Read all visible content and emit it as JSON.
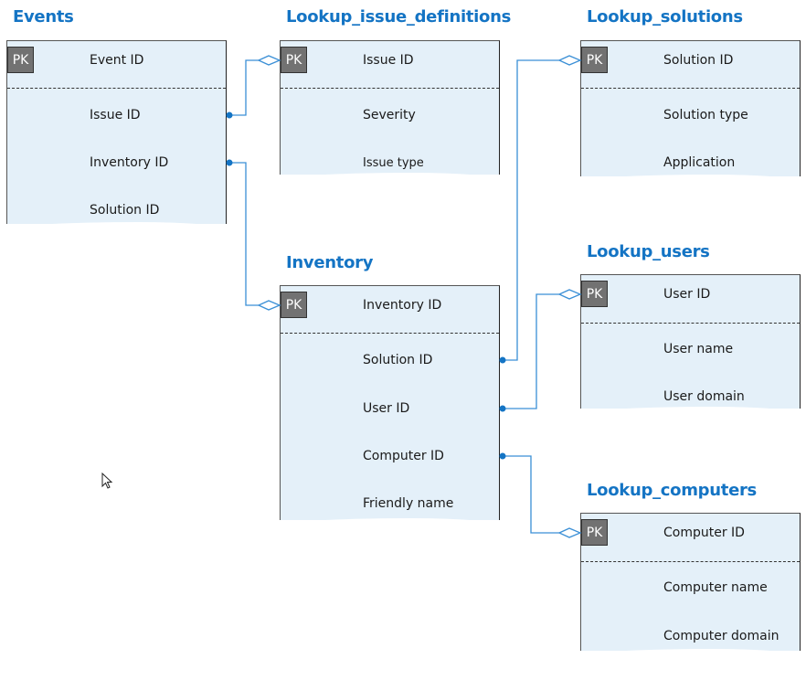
{
  "diagram": {
    "pk_label": "PK",
    "accent_color": "#1474c4",
    "entities": [
      {
        "id": "events",
        "title": "Events",
        "pk_field": "Event ID",
        "fields": [
          "Issue ID",
          "Inventory ID",
          "Solution ID"
        ]
      },
      {
        "id": "lookup_issue_definitions",
        "title": "Lookup_issue_definitions",
        "pk_field": "Issue ID",
        "fields": [
          "Severity",
          "Issue type"
        ]
      },
      {
        "id": "lookup_solutions",
        "title": "Lookup_solutions",
        "pk_field": "Solution ID",
        "fields": [
          "Solution type",
          "Application"
        ]
      },
      {
        "id": "inventory",
        "title": "Inventory",
        "pk_field": "Inventory ID",
        "fields": [
          "Solution ID",
          "User ID",
          "Computer ID",
          "Friendly name"
        ]
      },
      {
        "id": "lookup_users",
        "title": "Lookup_users",
        "pk_field": "User ID",
        "fields": [
          "User name",
          "User domain"
        ]
      },
      {
        "id": "lookup_computers",
        "title": "Lookup_computers",
        "pk_field": "Computer ID",
        "fields": [
          "Computer name",
          "Computer domain"
        ]
      }
    ],
    "relationships": [
      {
        "from": "Events.Issue ID",
        "to": "Lookup_issue_definitions.Issue ID"
      },
      {
        "from": "Events.Inventory ID",
        "to": "Inventory.Inventory ID"
      },
      {
        "from": "Inventory.Solution ID",
        "to": "Lookup_solutions.Solution ID"
      },
      {
        "from": "Inventory.User ID",
        "to": "Lookup_users.User ID"
      },
      {
        "from": "Inventory.Computer ID",
        "to": "Lookup_computers.Computer ID"
      }
    ]
  }
}
